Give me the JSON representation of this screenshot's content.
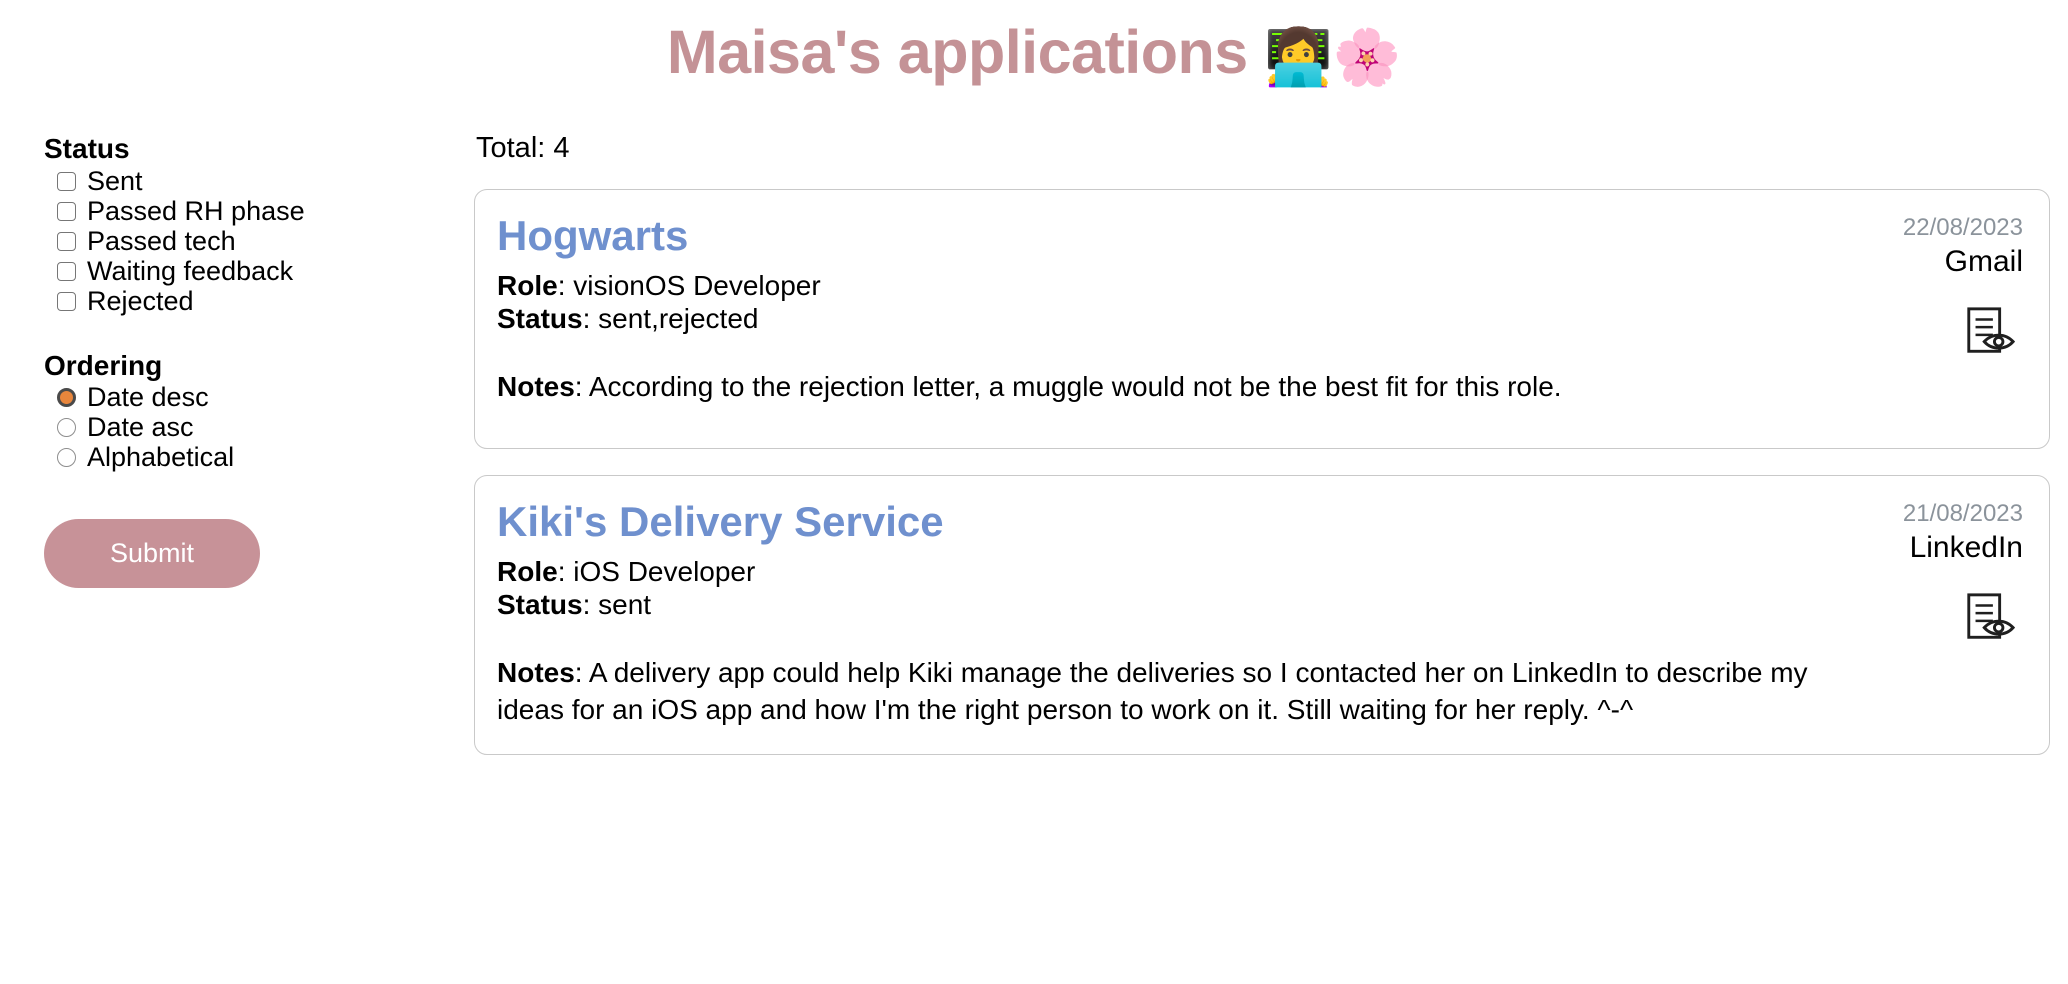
{
  "header": {
    "title": "Maisa's applications",
    "emoji_technologist": "👩‍💻",
    "emoji_blossom": "🌸"
  },
  "sidebar": {
    "status": {
      "title": "Status",
      "options": [
        {
          "label": "Sent",
          "checked": false
        },
        {
          "label": "Passed RH phase",
          "checked": false
        },
        {
          "label": "Passed tech",
          "checked": false
        },
        {
          "label": "Waiting feedback",
          "checked": false
        },
        {
          "label": "Rejected",
          "checked": false
        }
      ]
    },
    "ordering": {
      "title": "Ordering",
      "options": [
        {
          "label": "Date desc",
          "selected": true
        },
        {
          "label": "Date asc",
          "selected": false
        },
        {
          "label": "Alphabetical",
          "selected": false
        }
      ]
    },
    "submit_label": "Submit"
  },
  "main": {
    "total_label": "Total: 4",
    "total_count": 4,
    "field_labels": {
      "role": "Role",
      "status": "Status",
      "notes": "Notes"
    },
    "cards": [
      {
        "company": "Hogwarts",
        "role": "visionOS Developer",
        "status": "sent,rejected",
        "notes": "According to the rejection letter, a muggle would not be the best fit for this role.",
        "date": "22/08/2023",
        "source": "Gmail",
        "detail_icon": "document-view-icon"
      },
      {
        "company": "Kiki's Delivery Service",
        "role": "iOS Developer",
        "status": "sent",
        "notes": "A delivery app could help Kiki manage the deliveries so I contacted her on LinkedIn to describe my ideas for an iOS app and how I'm the right person to work on it. Still waiting for her reply. ^-^",
        "date": "21/08/2023",
        "source": "LinkedIn",
        "detail_icon": "document-view-icon"
      }
    ]
  },
  "colors": {
    "title_rose": "#c49296",
    "card_title_blue": "#6f90ce",
    "submit_bg": "#c79298",
    "radio_accent": "#e8863c",
    "date_gray": "#8b939b",
    "card_border": "#c9c9c9"
  }
}
